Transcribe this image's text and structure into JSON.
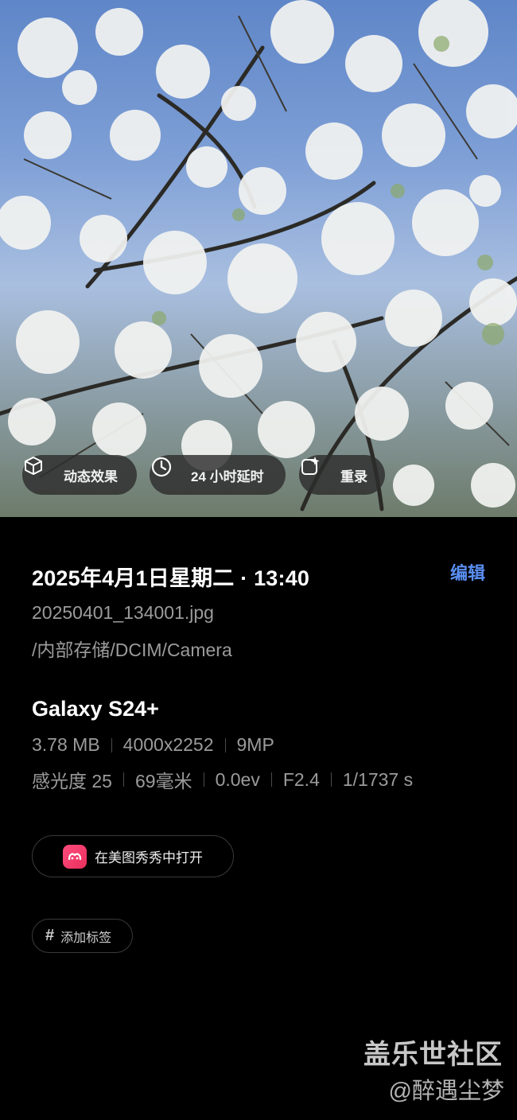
{
  "photo": {
    "description_icon": "photo-image"
  },
  "actions": [
    {
      "label": "动态效果",
      "icon": "motion-cube-icon"
    },
    {
      "label": "24 小时延时",
      "icon": "timelapse-clock-icon"
    },
    {
      "label": "重录",
      "icon": "remaster-sparkle-icon"
    }
  ],
  "details": {
    "datetime": "2025年4月1日星期二 · 13:40",
    "edit_label": "编辑",
    "filename": "20250401_134001.jpg",
    "path": "/内部存储/DCIM/Camera",
    "device": "Galaxy S24+",
    "size": "3.78 MB",
    "resolution": "4000x2252",
    "megapixels": "9MP",
    "iso": "感光度 25",
    "focal": "69毫米",
    "ev": "0.0ev",
    "aperture": "F2.4",
    "shutter": "1/1737 s"
  },
  "open_in": {
    "label": "在美图秀秀中打开",
    "icon": "meitu-app-icon"
  },
  "tag": {
    "hash": "#",
    "label": "添加标签"
  },
  "watermark": {
    "line1": "盖乐世社区",
    "line2": "@醉遇尘梦"
  },
  "colors": {
    "accent": "#5b8ff3",
    "secondary_text": "#9b9b9b",
    "background": "#000000"
  }
}
